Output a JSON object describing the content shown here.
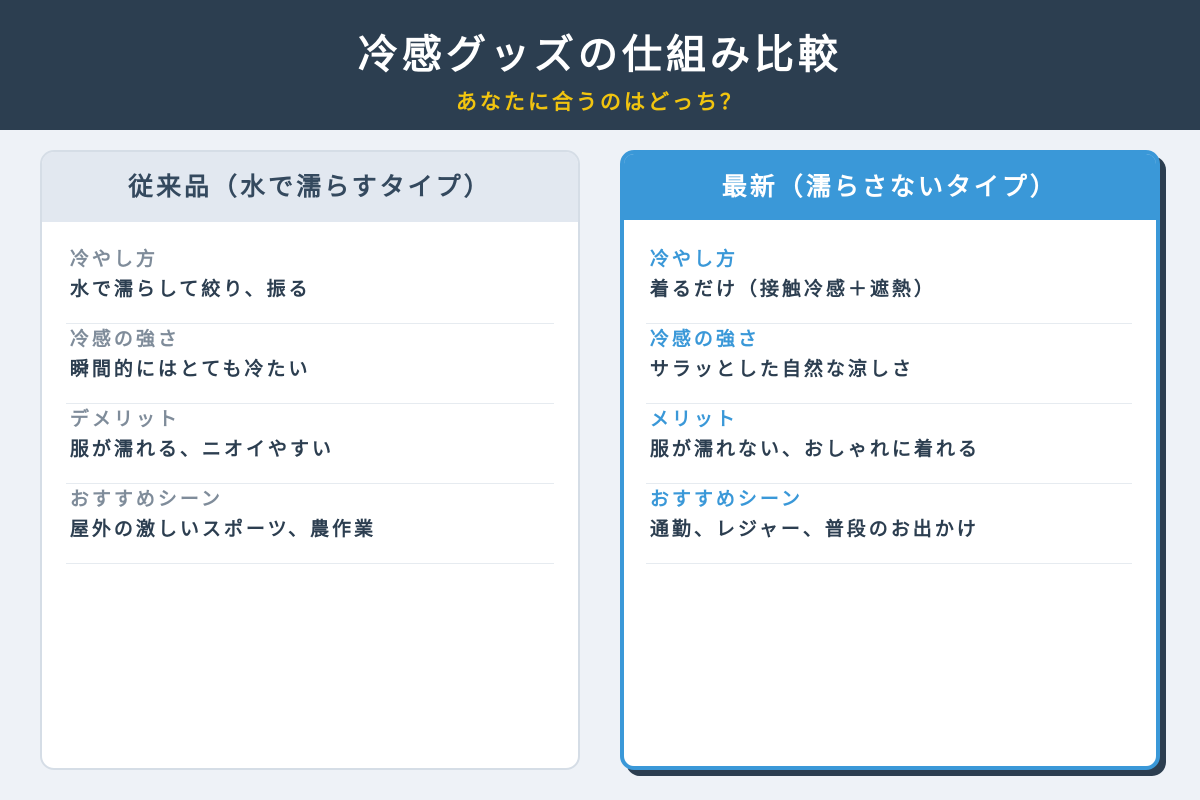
{
  "header": {
    "title": "冷感グッズの仕組み比較",
    "subtitle": "あなたに合うのはどっち？"
  },
  "left_card": {
    "title": "従来品（水で濡らすタイプ）",
    "rows": [
      {
        "label": "冷やし方",
        "value": "水で濡らして絞り、振る"
      },
      {
        "label": "冷感の強さ",
        "value": "瞬間的にはとても冷たい"
      },
      {
        "label": "デメリット",
        "value": "服が濡れる、ニオイやすい"
      },
      {
        "label": "おすすめシーン",
        "value": "屋外の激しいスポーツ、農作業"
      }
    ]
  },
  "right_card": {
    "title": "最新（濡らさないタイプ）",
    "rows": [
      {
        "label": "冷やし方",
        "value": "着るだけ（接触冷感＋遮熱）"
      },
      {
        "label": "冷感の強さ",
        "value": "サラッとした自然な涼しさ"
      },
      {
        "label": "メリット",
        "value": "服が濡れない、おしゃれに着れる"
      },
      {
        "label": "おすすめシーン",
        "value": "通勤、レジャー、普段のお出かけ"
      }
    ]
  },
  "colors": {
    "header_bg": "#2c3e50",
    "subtitle": "#f1c40f",
    "accent": "#3a98d8",
    "page_bg": "#eef2f7"
  }
}
